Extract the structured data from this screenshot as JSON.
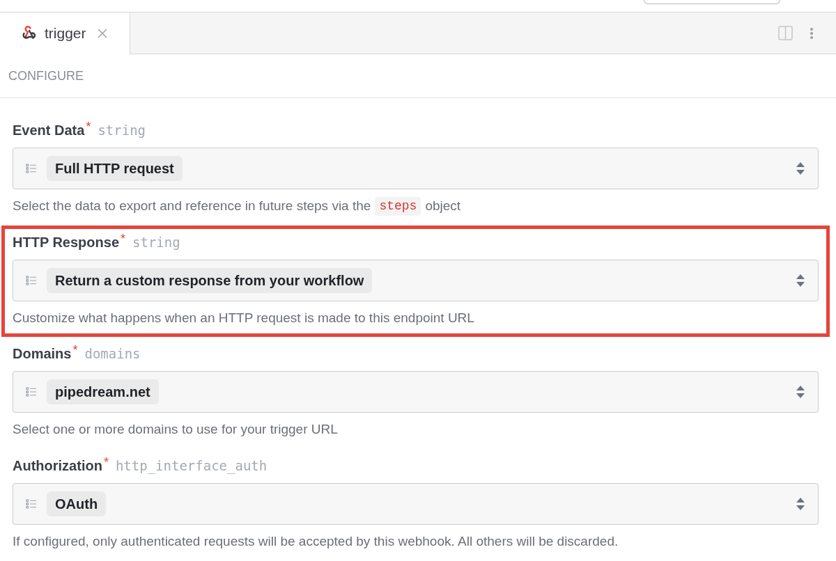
{
  "tab": {
    "label": "trigger",
    "selected": true
  },
  "section_title": "CONFIGURE",
  "fields": [
    {
      "label": "Event Data",
      "required_mark": "*",
      "type": "string",
      "value": "Full HTTP request",
      "highlighted": false,
      "help": [
        {
          "kind": "text",
          "text": "Select the data to export and reference in future steps via the"
        },
        {
          "kind": "code",
          "text": "steps"
        },
        {
          "kind": "text",
          "text": "object"
        }
      ]
    },
    {
      "label": "HTTP Response",
      "required_mark": "*",
      "type": "string",
      "value": "Return a custom response from your workflow",
      "highlighted": true,
      "help": [
        {
          "kind": "text",
          "text": "Customize what happens when an HTTP request is made to this endpoint URL"
        }
      ]
    },
    {
      "label": "Domains",
      "required_mark": "*",
      "type": "domains",
      "value": "pipedream.net",
      "highlighted": false,
      "help": [
        {
          "kind": "text",
          "text": "Select one or more domains to use for your trigger URL"
        }
      ]
    },
    {
      "label": "Authorization",
      "required_mark": "*",
      "type": "http_interface_auth",
      "value": "OAuth",
      "highlighted": false,
      "help": [
        {
          "kind": "text",
          "text": "If configured, only authenticated requests will be accepted by this webhook. All others will be discarded."
        }
      ]
    }
  ]
}
